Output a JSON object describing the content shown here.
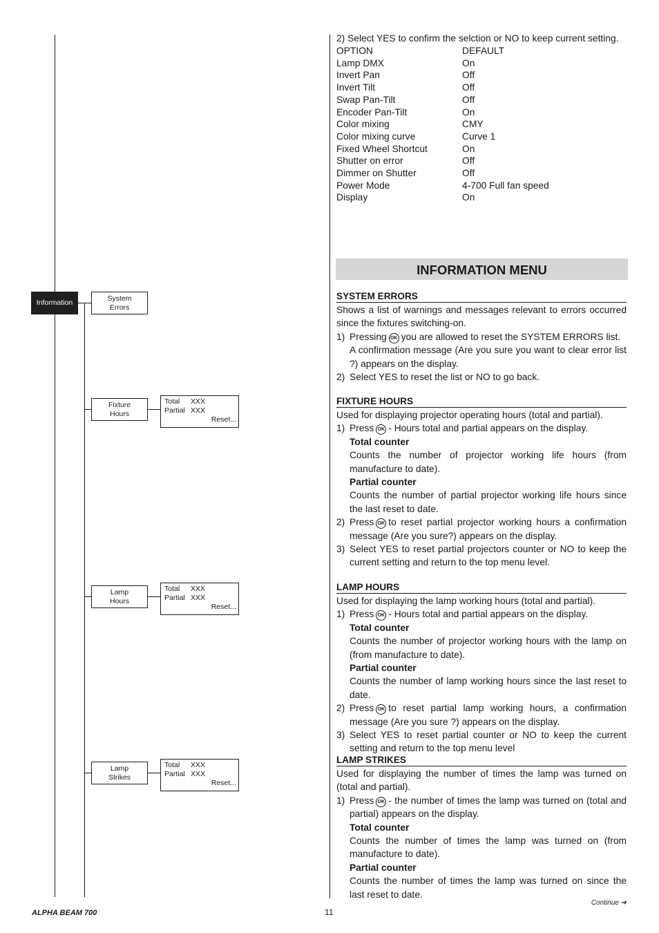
{
  "options_intro": "2) Select YES to confirm the selction or NO to keep current setting.",
  "options_table": {
    "headers": [
      "OPTION",
      "DEFAULT"
    ],
    "rows": [
      [
        "Lamp DMX",
        "On"
      ],
      [
        "Invert Pan",
        "Off"
      ],
      [
        "Invert Tilt",
        "Off"
      ],
      [
        "Swap Pan-Tilt",
        "Off"
      ],
      [
        "Encoder Pan-Tilt",
        "On"
      ],
      [
        "Color mixing",
        "CMY"
      ],
      [
        "Color mixing curve",
        "Curve 1"
      ],
      [
        "Fixed Wheel Shortcut",
        "On"
      ],
      [
        "Shutter on error",
        "Off"
      ],
      [
        "Dimmer on Shutter",
        "Off"
      ],
      [
        "Power Mode",
        "4-700 Full fan speed"
      ],
      [
        "Display",
        "On"
      ]
    ]
  },
  "menu_tree": {
    "root": "Information",
    "items": [
      {
        "line1": "System",
        "line2": "Errors"
      },
      {
        "line1": "Fixture",
        "line2": "Hours",
        "display": {
          "total_label": "Total",
          "total_value": "XXX",
          "partial_label": "Partial",
          "partial_value": "XXX",
          "reset": "Reset..."
        }
      },
      {
        "line1": "Lamp",
        "line2": "Hours",
        "display": {
          "total_label": "Total",
          "total_value": "XXX",
          "partial_label": "Partial",
          "partial_value": "XXX",
          "reset": "Reset..."
        }
      },
      {
        "line1": "Lamp",
        "line2": "Strikes",
        "display": {
          "total_label": "Total",
          "total_value": "XXX",
          "partial_label": "Partial",
          "partial_value": "XXX",
          "reset": "Reset..."
        }
      }
    ]
  },
  "banner_title": "INFORMATION MENU",
  "ok_icon_label": "OK",
  "sections": {
    "system_errors": {
      "title": "SYSTEM ERRORS",
      "intro": "Shows a list of warnings and messages relevant to errors occurred since the fixtures switching-on.",
      "step1_num": "1)",
      "step1_pre": "Pressing",
      "step1_post": "you are allowed to reset the SYSTEM ERRORS list.",
      "step1_cont": "A confirmation message (Are you sure you want to clear error list ?) appears on the display.",
      "step2_num": "2)",
      "step2": "Select YES to reset the list or NO to go back."
    },
    "fixture_hours": {
      "title": "FIXTURE HOURS",
      "intro": "Used for displaying projector operating hours (total and partial).",
      "step1_num": "1)",
      "step1_pre": "Press",
      "step1_post": "- Hours total and partial appears on the display.",
      "total_title": "Total counter",
      "total_text": "Counts the number of projector working life hours (from manufacture to date).",
      "partial_title": "Partial counter",
      "partial_text": "Counts the number of partial projector working life hours since the last reset to date.",
      "step2_num": "2)",
      "step2_pre": "Press",
      "step2_post": "to reset partial projector working hours a confirmation message (Are you sure?) appears on the display.",
      "step3_num": "3)",
      "step3": "Select YES to reset partial projectors counter or NO to keep the current setting and return to the top menu level."
    },
    "lamp_hours": {
      "title": "LAMP HOURS",
      "intro": "Used for displaying the lamp working hours (total and partial).",
      "step1_num": "1)",
      "step1_pre": "Press",
      "step1_post": "- Hours total and partial appears on the display.",
      "total_title": "Total counter",
      "total_text": "Counts the number of projector working hours with the lamp on (from manufacture to date).",
      "partial_title": "Partial counter",
      "partial_text": "Counts the number of lamp working hours since the last reset to date.",
      "step2_num": "2)",
      "step2_pre": "Press",
      "step2_post": "to reset partial lamp working hours, a confirmation message (Are you sure ?) appears on the display.",
      "step3_num": "3)",
      "step3": "Select YES to reset partial counter or NO to keep the current setting and return to the top menu level"
    },
    "lamp_strikes": {
      "title": "LAMP STRIKES",
      "intro": "Used for displaying the number of times the lamp was turned on (total and partial).",
      "step1_num": "1)",
      "step1_pre": "Press",
      "step1_post": "- the number of times the lamp was turned on (total and partial) appears on the display.",
      "total_title": "Total counter",
      "total_text": "Counts the number of times the lamp was turned on (from manufacture to date).",
      "partial_title": "Partial counter",
      "partial_text": "Counts the number of times the lamp was turned on since the last reset to date."
    }
  },
  "footer": {
    "product": "ALPHA BEAM 700",
    "page": "11",
    "continue": "Continue ➔"
  }
}
